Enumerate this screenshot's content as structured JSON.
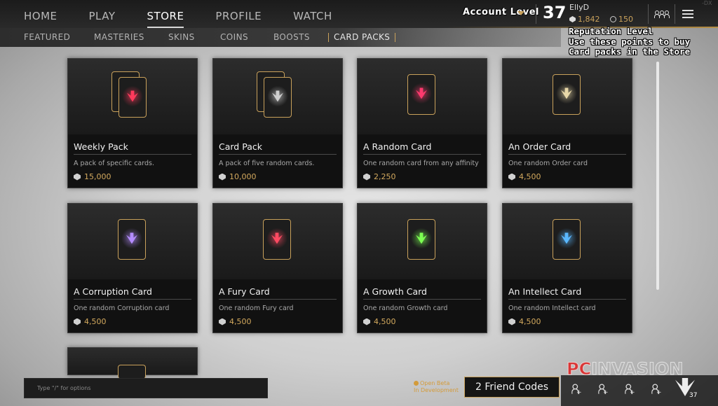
{
  "main_nav": {
    "tabs": [
      "HOME",
      "PLAY",
      "STORE",
      "PROFILE",
      "WATCH"
    ],
    "active": "STORE"
  },
  "account": {
    "label": "Account Level",
    "level": "37",
    "username": "EllyD",
    "gems": "1,842",
    "coins": "150"
  },
  "reputation_note": "Reputation Level\nUse these points to buy\nCard packs in the Store",
  "sub_nav": {
    "tabs": [
      "FEATURED",
      "MASTERIES",
      "SKINS",
      "COINS",
      "BOOSTS",
      "CARD PACKS"
    ],
    "active": "CARD PACKS"
  },
  "cards": [
    {
      "name": "Weekly Pack",
      "desc": "A pack of specific cards.",
      "price": "15,000",
      "kind": "pack",
      "glow": "#ff3a5c"
    },
    {
      "name": "Card Pack",
      "desc": "A pack of five random cards.",
      "price": "10,000",
      "kind": "pack",
      "glow": "#cfcfcf"
    },
    {
      "name": "A Random Card",
      "desc": "One random card from any affinity",
      "price": "2,250",
      "kind": "single",
      "glow": "#ff3a6e"
    },
    {
      "name": "An Order Card",
      "desc": "One random Order card",
      "price": "4,500",
      "kind": "single",
      "glow": "#e8d8a8"
    },
    {
      "name": "A Corruption Card",
      "desc": "One random Corruption card",
      "price": "4,500",
      "kind": "single",
      "glow": "#b48cff"
    },
    {
      "name": "A Fury Card",
      "desc": "One random Fury card",
      "price": "4,500",
      "kind": "single",
      "glow": "#ff4a62"
    },
    {
      "name": "A Growth Card",
      "desc": "One random Growth card",
      "price": "4,500",
      "kind": "single",
      "glow": "#7cff52"
    },
    {
      "name": "An Intellect Card",
      "desc": "One random Intellect card",
      "price": "4,500",
      "kind": "single",
      "glow": "#5ab8ff"
    }
  ],
  "chat": {
    "placeholder": "Type \"/\" for options"
  },
  "beta_notice": "Open Beta\nIn Development",
  "friend_codes": "2 Friend Codes",
  "bottom_level": "37",
  "watermark": {
    "pc": "PC",
    "rest": "INVASION"
  },
  "corner_mark": "-DX",
  "colors": {
    "accent_gold": "#c9a15b",
    "price": "#d3a95e",
    "panel": "#141414"
  }
}
